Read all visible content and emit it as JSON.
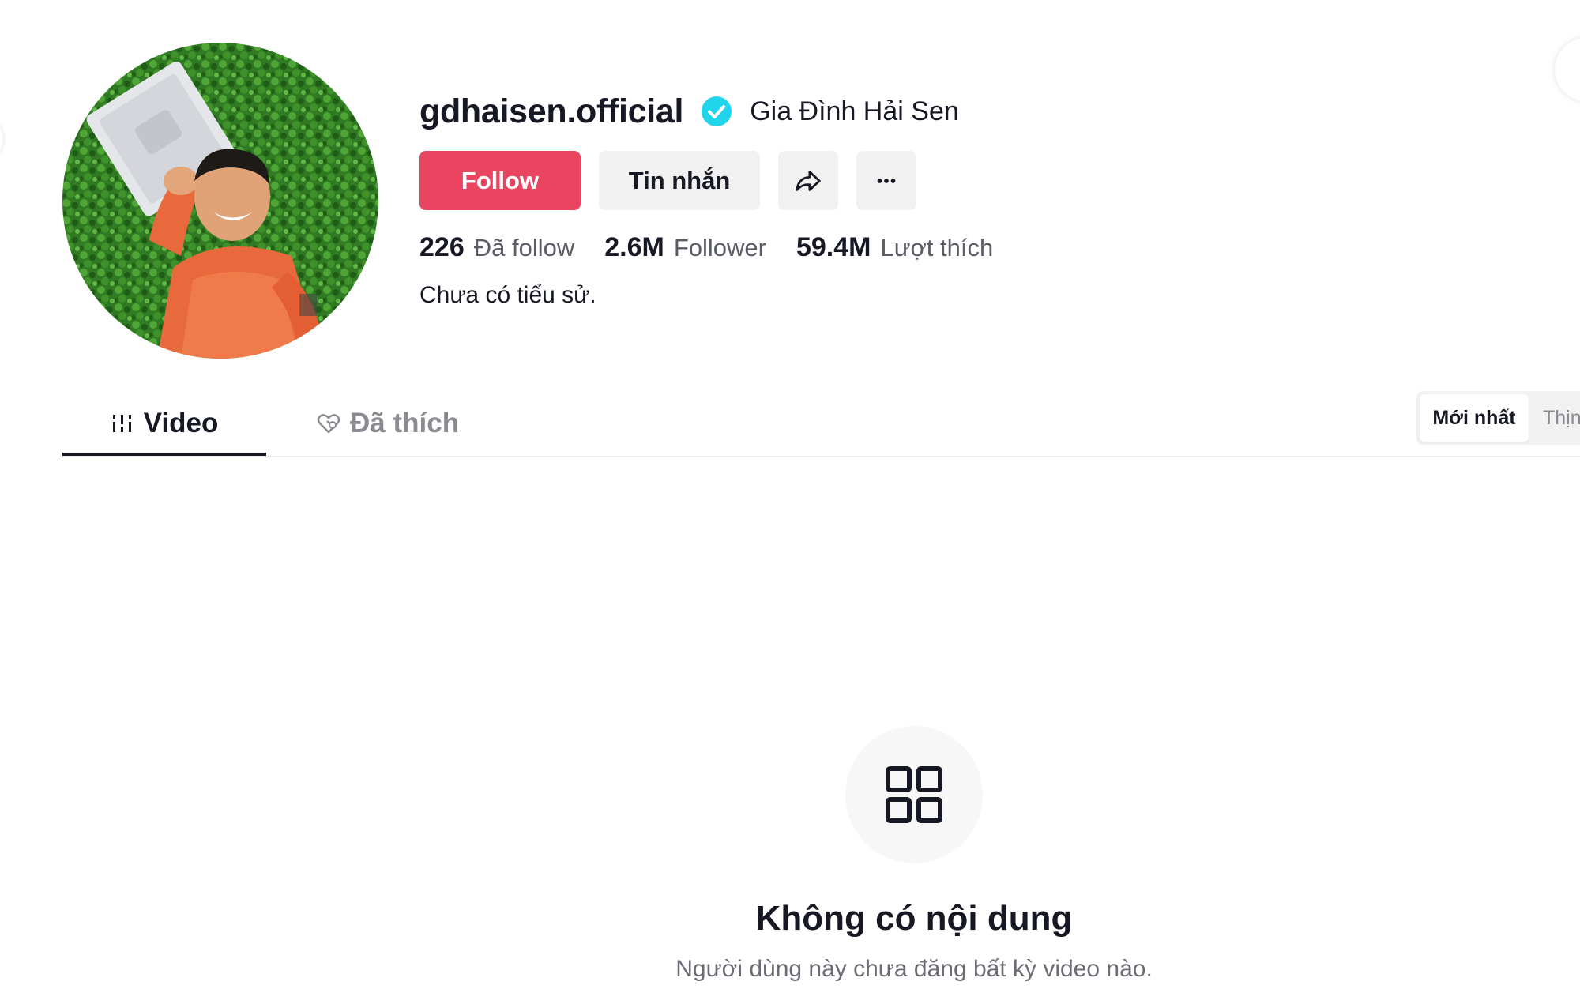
{
  "profile": {
    "username": "gdhaisen.official",
    "nickname": "Gia Đình Hải Sen",
    "verified": true,
    "bio": "Chưa có tiểu sử."
  },
  "actions": {
    "follow_label": "Follow",
    "message_label": "Tin nhắn",
    "share_icon": "share-icon",
    "more_icon": "more-icon"
  },
  "stats": [
    {
      "value": "226",
      "label": "Đã follow"
    },
    {
      "value": "2.6M",
      "label": "Follower"
    },
    {
      "value": "59.4M",
      "label": "Lượt thích"
    }
  ],
  "tabs": [
    {
      "label": "Video",
      "icon": "grid-lines-icon",
      "active": true
    },
    {
      "label": "Đã thích",
      "icon": "liked-heart-icon",
      "active": false
    }
  ],
  "sort": {
    "newest_label": "Mới nhất",
    "popular_label": "Thịnh"
  },
  "empty_state": {
    "icon": "grid-icon",
    "title": "Không có nội dung",
    "description": "Người dùng này chưa đăng bất kỳ video nào."
  },
  "colors": {
    "follow_button": "#ea4460",
    "verified_badge": "#20d5ec",
    "text_primary": "#161823",
    "text_secondary": "#5a5c66"
  }
}
